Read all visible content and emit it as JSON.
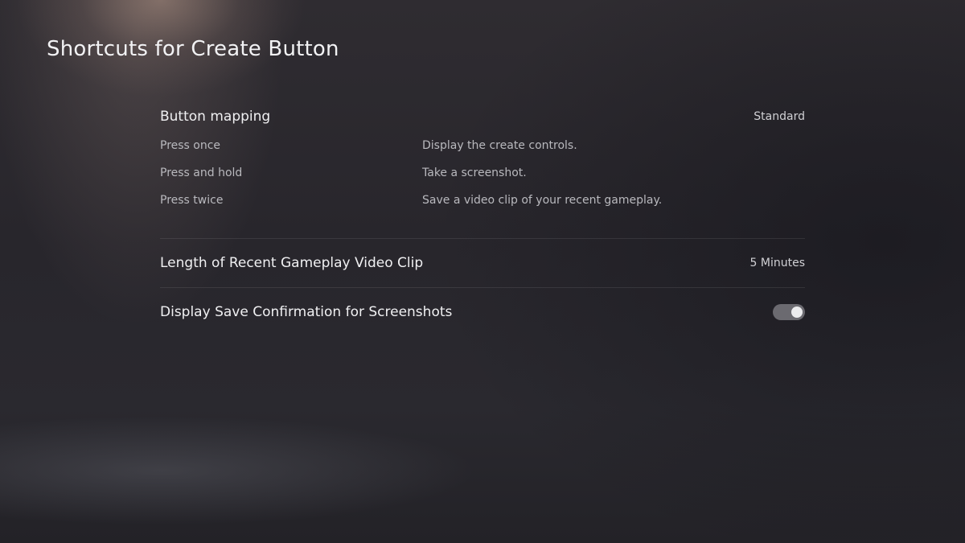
{
  "page": {
    "title": "Shortcuts for Create Button"
  },
  "button_mapping": {
    "title": "Button mapping",
    "value": "Standard",
    "rows": [
      {
        "action": "Press once",
        "result": "Display the create controls."
      },
      {
        "action": "Press and hold",
        "result": "Take a screenshot."
      },
      {
        "action": "Press twice",
        "result": "Save a video clip of your recent gameplay."
      }
    ]
  },
  "settings": {
    "clip_length": {
      "label": "Length of Recent Gameplay Video Clip",
      "value": "5 Minutes"
    },
    "save_confirmation": {
      "label": "Display Save Confirmation for Screenshots",
      "enabled": true
    }
  },
  "colors": {
    "toggle_on_track": "#6b6a70",
    "toggle_knob": "#ececee"
  }
}
